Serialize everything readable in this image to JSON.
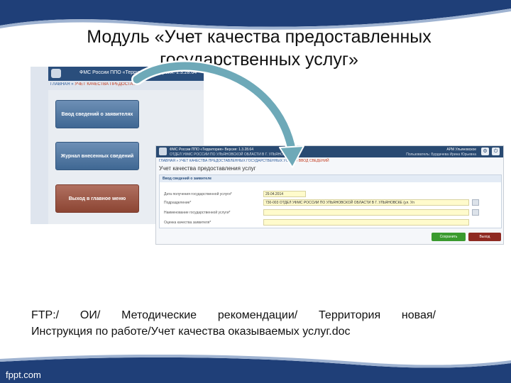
{
  "slide": {
    "title_line1": "Модуль «Учет качества предоставленных",
    "title_line2": "государственных услуг»",
    "body_line1": "FTP:/ ОИ/ Методические рекомендации/ Территория новая/",
    "body_line2": "Инструкция по работе/Учет качества оказываемых услуг.doc",
    "footer": "fppt.com"
  },
  "screen1": {
    "header_text": "ФМС России ППО «Территория»  Версия: 1.3.28.64",
    "breadcrumb_home": "ГЛАВНАЯ",
    "breadcrumb_sep": " » ",
    "breadcrumb_current": "УЧЕТ КАЧЕСТВА ПРЕДОСТА...",
    "buttons": [
      "Ввод сведений о заявителях",
      "Журнал внесенных сведений",
      "Выход в главное меню"
    ]
  },
  "screen2": {
    "header_line1": "ФМС России ППО «Территория»  Версия: 1.3.28.64",
    "header_line2": "ОТДЕЛ УФМС РОССИИ ПО УЛЬЯНОВСКОЙ ОБЛАСТИ В Г. УЛЬЯНОВСКЕ",
    "user_line1": "АРМ Ульяновское",
    "user_line2": "Пользователь: Бурдачева Ирина Юрьевна",
    "breadcrumb_home": "ГЛАВНАЯ",
    "breadcrumb_sep": " » ",
    "breadcrumb_mid": "УЧЕТ КАЧЕСТВА ПРЕДОСТАВЛЕННЫХ ГОСУДАРСТВЕННЫХ УСЛУГ",
    "breadcrumb_current": " » ВВОД СВЕДЕНИЙ",
    "page_title": "Учет качества предоставления услуг",
    "panel_title": "Ввод сведений о заявителе",
    "fields": [
      {
        "label": "Дата получения государственной услуги*",
        "value": "29.04.2014"
      },
      {
        "label": "Подразделение*",
        "value": "730-003 ОТДЕЛ УФМС РОССИИ ПО УЛЬЯНОВСКОЙ ОБЛАСТИ В Г. УЛЬЯНОВСКЕ (ул. Ул"
      },
      {
        "label": "Наименование государственной услуги*",
        "value": ""
      },
      {
        "label": "Оценка качества заявителя*",
        "value": ""
      }
    ],
    "save_label": "Сохранить",
    "exit_label": "Выход"
  },
  "colors": {
    "band_blue": "#1f3f78",
    "header_blue": "#2a4e7c",
    "button_blue": "#4f759f",
    "button_red": "#9a5444",
    "field_yellow": "#fffbcc",
    "save_green": "#3a9a2e",
    "exit_red": "#8e2a22",
    "arrow_teal": "#6ea9b8"
  },
  "icons": [
    "emblem-icon",
    "gear-icon",
    "power-icon",
    "lookup-icon",
    "curved-arrow-icon"
  ]
}
